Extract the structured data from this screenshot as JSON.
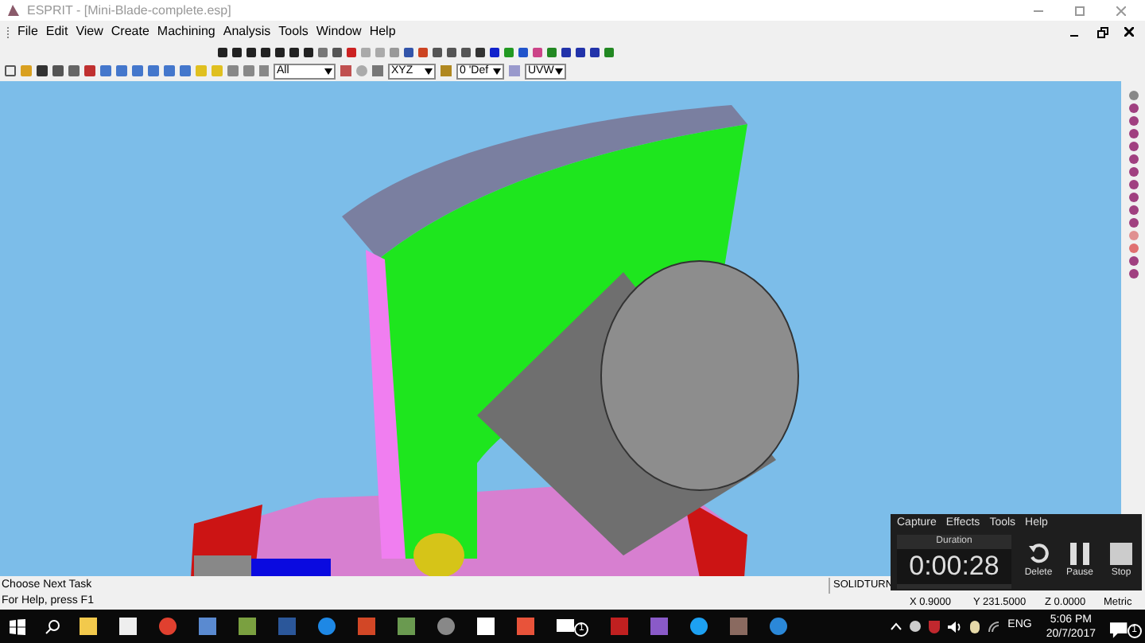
{
  "window": {
    "title": "ESPRIT - [Mini-Blade-complete.esp]"
  },
  "menu": [
    "File",
    "Edit",
    "View",
    "Create",
    "Machining",
    "Analysis",
    "Tools",
    "Window",
    "Help"
  ],
  "toolbar": {
    "selection_filter": "All",
    "coordinate_system": "XYZ",
    "work_plane": "0 'Def",
    "uv_system": "UVW"
  },
  "status_bar": {
    "task": "Choose Next Task",
    "help": "For Help, press F1",
    "mode": "SOLIDTURN",
    "x": "X 0.9000",
    "y": "Y 231.5000",
    "z": "Z 0.0000",
    "units": "Metric"
  },
  "recorder": {
    "menu": [
      "Capture",
      "Effects",
      "Tools",
      "Help"
    ],
    "duration_label": "Duration",
    "duration": "0:00:28",
    "buttons": [
      {
        "kind": "delete",
        "label": "Delete"
      },
      {
        "kind": "pause",
        "label": "Pause"
      },
      {
        "kind": "stop",
        "label": "Stop"
      }
    ]
  },
  "taskbar": {
    "mail_badge": "1",
    "language": "ENG",
    "time": "5:06 PM",
    "date": "20/7/2017",
    "notification_badge": "1"
  }
}
